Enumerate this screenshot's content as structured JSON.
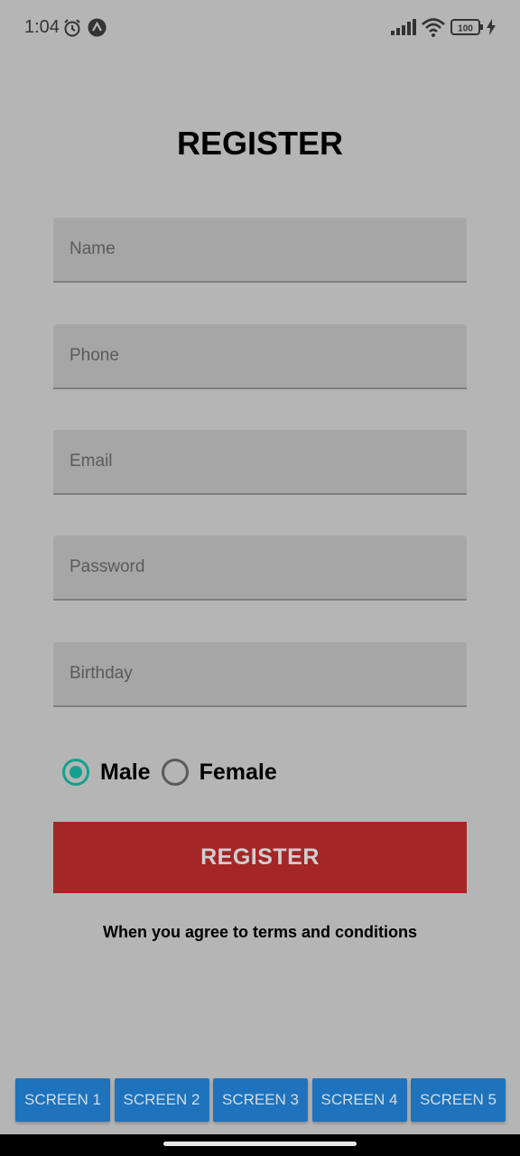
{
  "status_bar": {
    "time": "1:04",
    "battery": "100",
    "icons": [
      "alarm-icon",
      "app-notification-icon",
      "cellular-signal-icon",
      "wifi-icon",
      "battery-icon",
      "charging-icon"
    ]
  },
  "form": {
    "title": "REGISTER",
    "fields": [
      {
        "placeholder": "Name",
        "value": ""
      },
      {
        "placeholder": "Phone",
        "value": ""
      },
      {
        "placeholder": "Email",
        "value": ""
      },
      {
        "placeholder": "Password",
        "value": ""
      },
      {
        "placeholder": "Birthday",
        "value": ""
      }
    ],
    "gender_options": [
      {
        "label": "Male",
        "selected": true
      },
      {
        "label": "Female",
        "selected": false
      }
    ],
    "submit_label": "REGISTER",
    "terms_text": "When you agree to terms and conditions"
  },
  "bottom_nav": {
    "buttons": [
      "SCREEN 1",
      "SCREEN 2",
      "SCREEN 3",
      "SCREEN 4",
      "SCREEN 5"
    ]
  },
  "colors": {
    "background": "#b5b5b5",
    "field_fill": "#a6a6a6",
    "radio_accent": "#15a08d",
    "register_button": "#a52626",
    "nav_button": "#1e73bc"
  }
}
